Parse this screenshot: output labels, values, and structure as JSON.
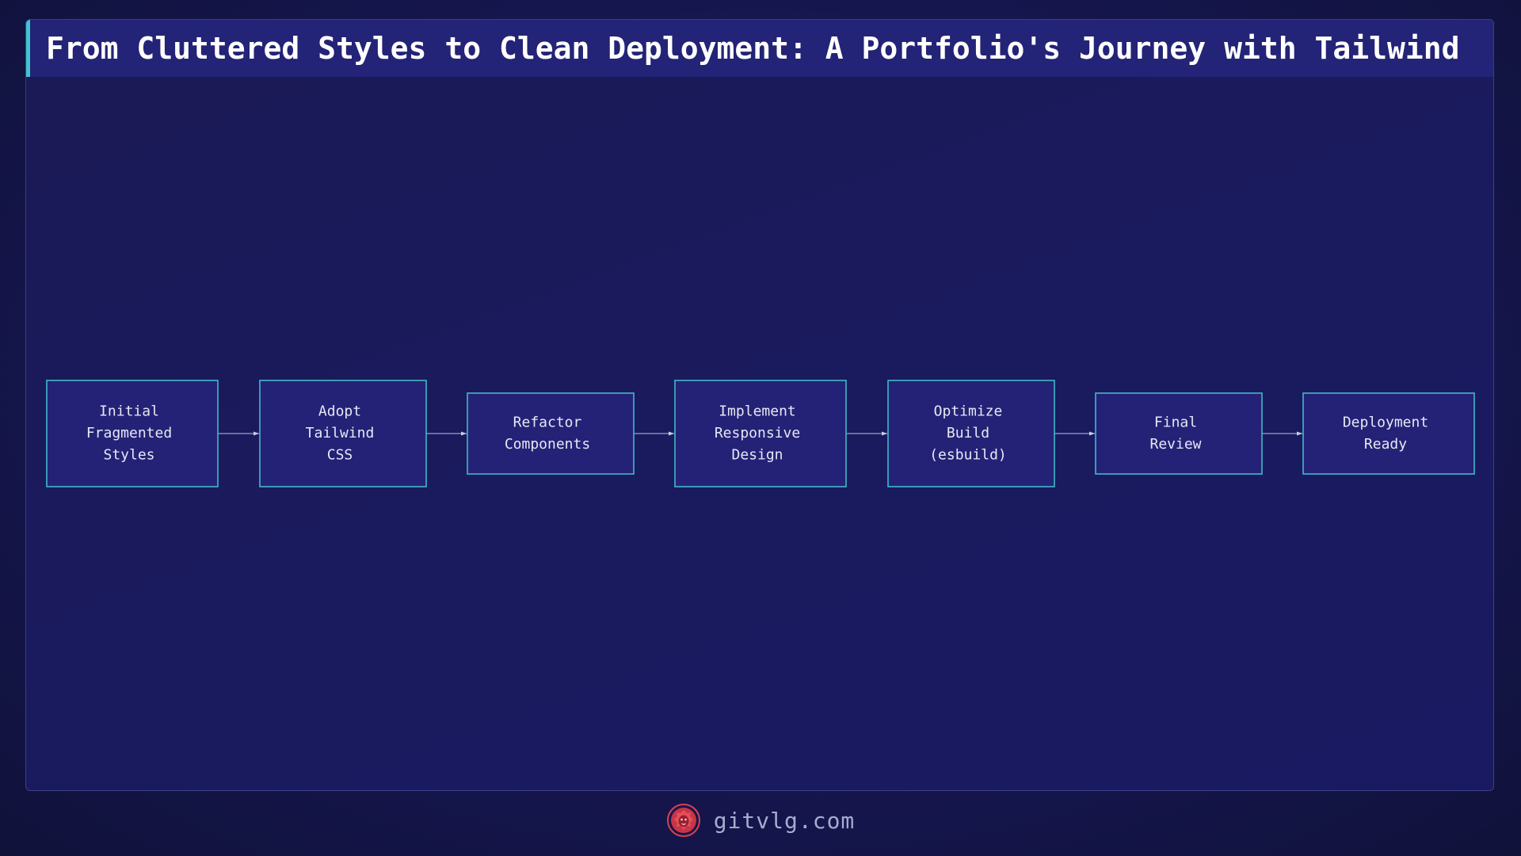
{
  "header": {
    "title": "From Cluttered Styles to Clean Deployment: A Portfolio's Journey with Tailwind …"
  },
  "diagram": {
    "nodes": [
      {
        "id": "initial",
        "lines": [
          "Initial",
          "Fragmented",
          "Styles"
        ]
      },
      {
        "id": "adopt",
        "lines": [
          "Adopt",
          "Tailwind",
          "CSS"
        ]
      },
      {
        "id": "refactor",
        "lines": [
          "Refactor",
          "Components"
        ]
      },
      {
        "id": "responsive",
        "lines": [
          "Implement",
          "Responsive",
          "Design"
        ]
      },
      {
        "id": "optimize",
        "lines": [
          "Optimize",
          "Build",
          "(esbuild)"
        ]
      },
      {
        "id": "review",
        "lines": [
          "Final",
          "Review"
        ]
      },
      {
        "id": "deploy",
        "lines": [
          "Deployment",
          "Ready"
        ]
      }
    ],
    "edges": [
      [
        "initial",
        "adopt"
      ],
      [
        "adopt",
        "refactor"
      ],
      [
        "refactor",
        "responsive"
      ],
      [
        "responsive",
        "optimize"
      ],
      [
        "optimize",
        "review"
      ],
      [
        "review",
        "deploy"
      ]
    ]
  },
  "footer": {
    "site": "gitvlg.com",
    "logo_icon": "lion-head-icon"
  },
  "colors": {
    "background": "#131542",
    "panel": "#1b1a5c",
    "title_bar": "#232377",
    "accent": "#3fc6cf",
    "node_fill": "#242276",
    "node_stroke": "#40b9c8",
    "logo": "#d8424f"
  }
}
